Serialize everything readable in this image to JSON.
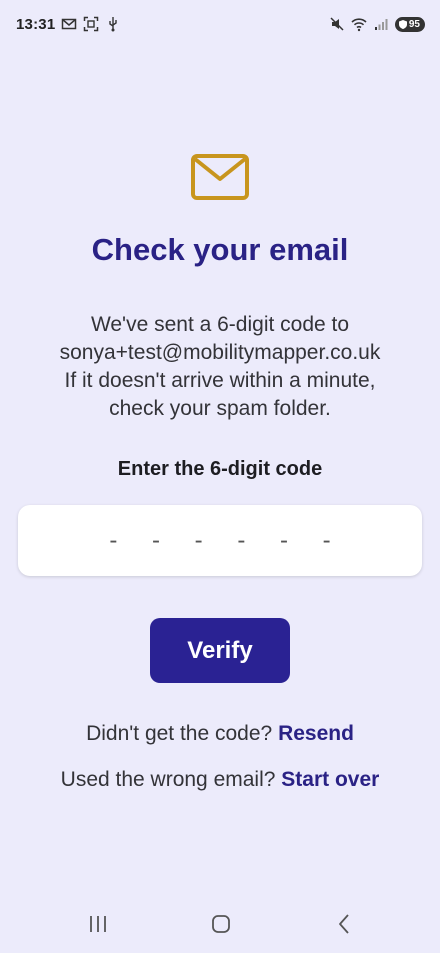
{
  "status_bar": {
    "time": "13:31",
    "left_icons": [
      "gmail-icon",
      "screenshot-icon",
      "usb-icon"
    ],
    "right_icons": [
      "mute-icon",
      "wifi-icon",
      "signal-icon"
    ],
    "battery": "95"
  },
  "main": {
    "icon": "mail-icon",
    "title": "Check your email",
    "message_lines": [
      "We've sent a 6-digit code to",
      "sonya+test@mobilitymapper.co.uk",
      "If it doesn't arrive within a minute,",
      "check your spam folder."
    ],
    "code_label": "Enter the 6-digit code",
    "code_placeholder": "- - - - - -",
    "verify_label": "Verify",
    "resend_prompt": "Didn't get the code?",
    "resend_link": "Resend",
    "startover_prompt": "Used the wrong email?",
    "startover_link": "Start over"
  },
  "nav_bar": {
    "buttons": [
      "recents-icon",
      "home-icon",
      "back-icon"
    ]
  },
  "colors": {
    "background": "#ecebfb",
    "accent": "#2a2285",
    "button": "#2a2293",
    "mail_icon": "#c8951e"
  }
}
